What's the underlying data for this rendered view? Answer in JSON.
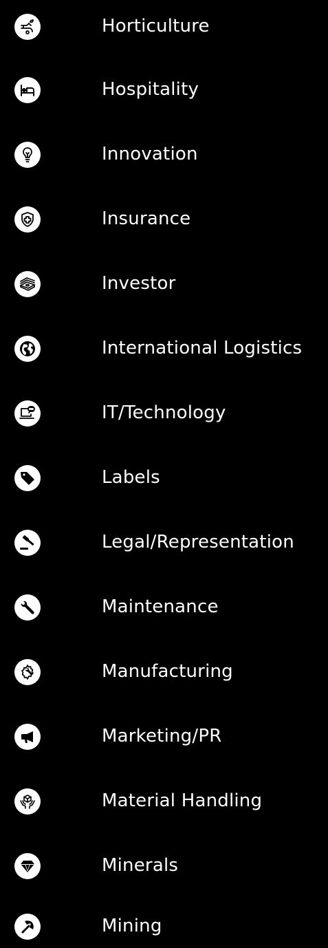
{
  "colors": {
    "background": "#000000",
    "badge": "#ffffff",
    "text": "#ffffff",
    "icon": "#000000"
  },
  "items": [
    {
      "label": "Horticulture",
      "icon": "hand-sprout-icon"
    },
    {
      "label": "Hospitality",
      "icon": "hotel-bed-icon"
    },
    {
      "label": "Innovation",
      "icon": "lightbulb-icon"
    },
    {
      "label": "Insurance",
      "icon": "shield-cross-icon"
    },
    {
      "label": "Investor",
      "icon": "money-stack-icon"
    },
    {
      "label": "International Logistics",
      "icon": "globe-icon"
    },
    {
      "label": "IT/Technology",
      "icon": "laptop-chat-icon"
    },
    {
      "label": "Labels",
      "icon": "tag-icon"
    },
    {
      "label": "Legal/Representation",
      "icon": "gavel-icon"
    },
    {
      "label": "Maintenance",
      "icon": "wrench-icon"
    },
    {
      "label": "Manufacturing",
      "icon": "gear-wrench-icon"
    },
    {
      "label": "Marketing/PR",
      "icon": "megaphone-icon"
    },
    {
      "label": "Material Handling",
      "icon": "hands-box-icon"
    },
    {
      "label": "Minerals",
      "icon": "gem-icon"
    },
    {
      "label": "Mining",
      "icon": "pickaxe-icon"
    }
  ]
}
